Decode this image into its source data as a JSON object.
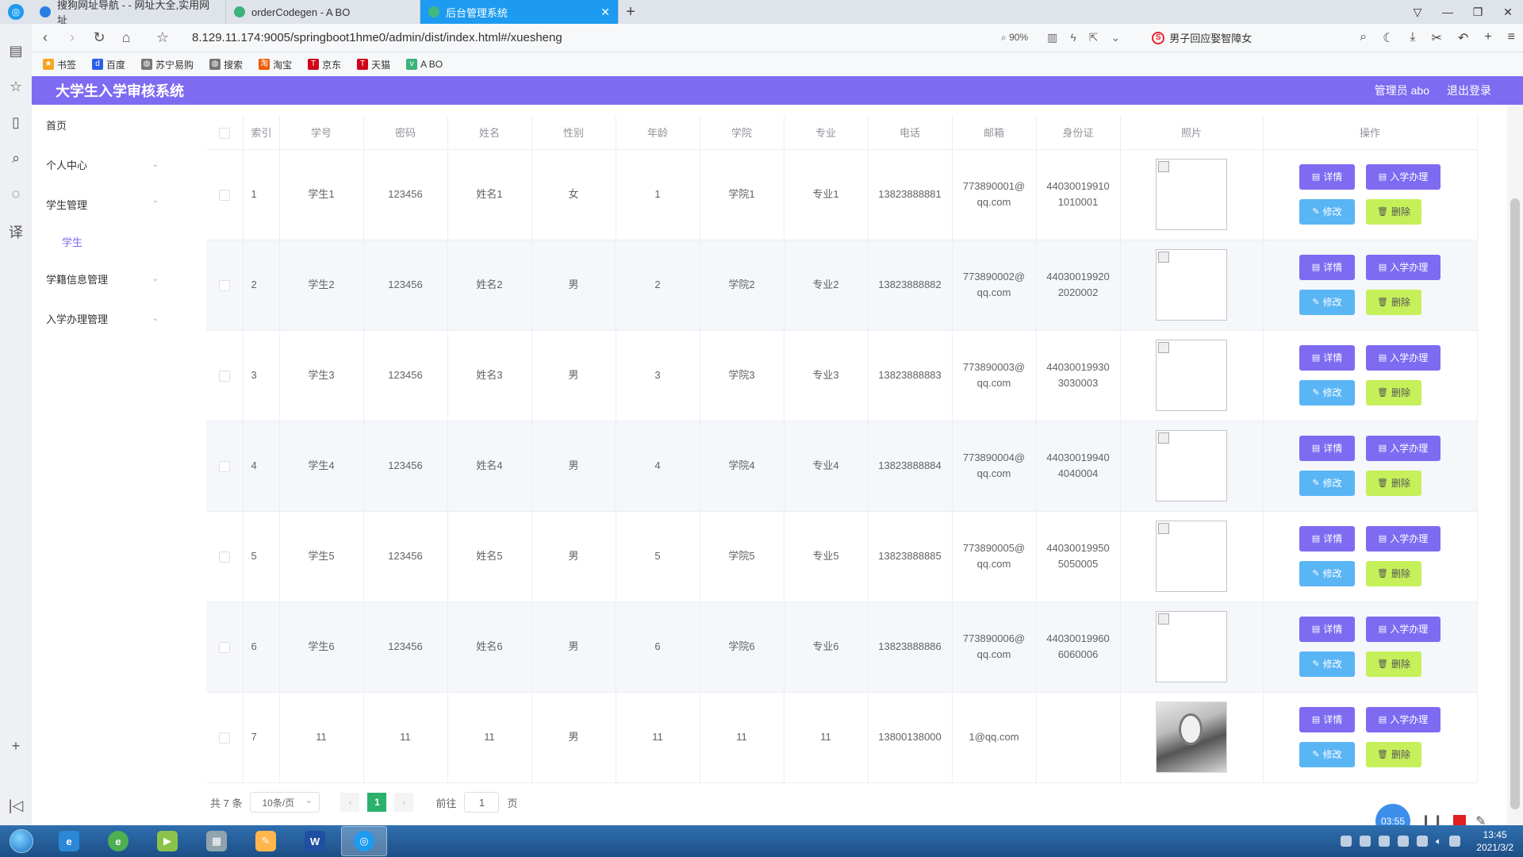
{
  "browser": {
    "tabs": [
      {
        "label": "搜狗网址导航 - - 网址大全,实用网址",
        "color": "#2a7de1"
      },
      {
        "label": "orderCodegen - A BO",
        "color": "#3bb37a"
      },
      {
        "label": "后台管理系统",
        "color": "#42b983"
      }
    ],
    "url": "8.129.11.174:9005/springboot1hme0/admin/dist/index.html#/xuesheng",
    "zoom": "90%",
    "search_text": "男子回应娶智障女",
    "bookmarks": [
      "书签",
      "百度",
      "苏宁易购",
      "搜索",
      "淘宝",
      "京东",
      "天猫",
      "A BO"
    ]
  },
  "app": {
    "title": "大学生入学审核系统",
    "user_label": "管理员 abo",
    "logout_label": "退出登录",
    "accent_color": "#7e6bf2"
  },
  "sidebar": {
    "items": [
      {
        "label": "首页",
        "has_arrow": false
      },
      {
        "label": "个人中心",
        "has_arrow": true
      },
      {
        "label": "学生管理",
        "has_arrow": true
      },
      {
        "label": "学生",
        "sub": true
      },
      {
        "label": "学籍信息管理",
        "has_arrow": true
      },
      {
        "label": "入学办理管理",
        "has_arrow": true
      }
    ]
  },
  "table": {
    "headers": [
      "索引",
      "学号",
      "密码",
      "姓名",
      "性别",
      "年龄",
      "学院",
      "专业",
      "电话",
      "邮箱",
      "身份证",
      "照片",
      "操作"
    ],
    "rows": [
      {
        "idx": "1",
        "xuehao": "学生1",
        "mima": "123456",
        "xingming": "姓名1",
        "xingbie": "女",
        "nianling": "1",
        "xueyuan": "学院1",
        "zhuanye": "专业1",
        "dianhua": "13823888881",
        "email_a": "773890001@",
        "email_b": "qq.com",
        "id_a": "44030019910",
        "id_b": "1010001",
        "photo": "broken"
      },
      {
        "idx": "2",
        "xuehao": "学生2",
        "mima": "123456",
        "xingming": "姓名2",
        "xingbie": "男",
        "nianling": "2",
        "xueyuan": "学院2",
        "zhuanye": "专业2",
        "dianhua": "13823888882",
        "email_a": "773890002@",
        "email_b": "qq.com",
        "id_a": "44030019920",
        "id_b": "2020002",
        "photo": "broken"
      },
      {
        "idx": "3",
        "xuehao": "学生3",
        "mima": "123456",
        "xingming": "姓名3",
        "xingbie": "男",
        "nianling": "3",
        "xueyuan": "学院3",
        "zhuanye": "专业3",
        "dianhua": "13823888883",
        "email_a": "773890003@",
        "email_b": "qq.com",
        "id_a": "44030019930",
        "id_b": "3030003",
        "photo": "broken"
      },
      {
        "idx": "4",
        "xuehao": "学生4",
        "mima": "123456",
        "xingming": "姓名4",
        "xingbie": "男",
        "nianling": "4",
        "xueyuan": "学院4",
        "zhuanye": "专业4",
        "dianhua": "13823888884",
        "email_a": "773890004@",
        "email_b": "qq.com",
        "id_a": "44030019940",
        "id_b": "4040004",
        "photo": "broken"
      },
      {
        "idx": "5",
        "xuehao": "学生5",
        "mima": "123456",
        "xingming": "姓名5",
        "xingbie": "男",
        "nianling": "5",
        "xueyuan": "学院5",
        "zhuanye": "专业5",
        "dianhua": "13823888885",
        "email_a": "773890005@",
        "email_b": "qq.com",
        "id_a": "44030019950",
        "id_b": "5050005",
        "photo": "broken"
      },
      {
        "idx": "6",
        "xuehao": "学生6",
        "mima": "123456",
        "xingming": "姓名6",
        "xingbie": "男",
        "nianling": "6",
        "xueyuan": "学院6",
        "zhuanye": "专业6",
        "dianhua": "13823888886",
        "email_a": "773890006@",
        "email_b": "qq.com",
        "id_a": "44030019960",
        "id_b": "6060006",
        "photo": "broken"
      },
      {
        "idx": "7",
        "xuehao": "11",
        "mima": "11",
        "xingming": "11",
        "xingbie": "男",
        "nianling": "11",
        "xueyuan": "11",
        "zhuanye": "11",
        "dianhua": "13800138000",
        "email_a": "1@qq.com",
        "email_b": "",
        "id_a": "",
        "id_b": "",
        "photo": "real"
      }
    ],
    "actions": {
      "detail": "详情",
      "enroll": "入学办理",
      "edit": "修改",
      "delete": "删除"
    }
  },
  "pagination": {
    "total": "共 7 条",
    "page_size": "10条/页",
    "current_page": "1",
    "goto_label": "前往",
    "goto_value": "1",
    "page_unit": "页"
  },
  "recorder": {
    "time": "03:55"
  },
  "taskbar": {
    "time": "13:45",
    "date": "2021/3/2"
  }
}
